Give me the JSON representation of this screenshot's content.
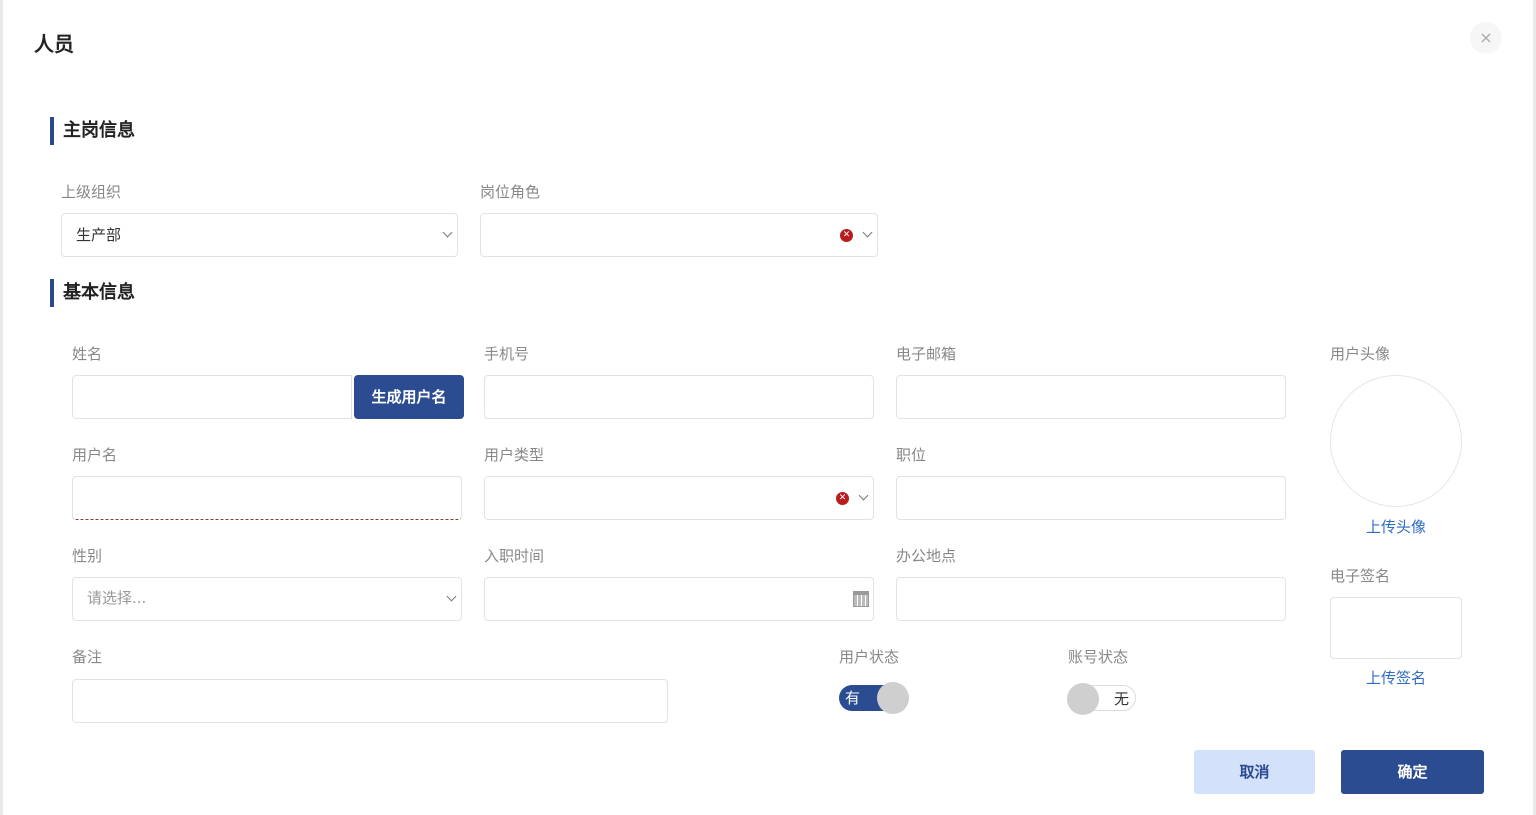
{
  "dialog": {
    "title": "人员",
    "close_symbol": "×"
  },
  "sections": {
    "main_post": "主岗信息",
    "basic_info": "基本信息"
  },
  "main_post": {
    "parent_org": {
      "label": "上级组织",
      "value": "生产部"
    },
    "post_role": {
      "label": "岗位角色",
      "value": ""
    }
  },
  "basic": {
    "name": {
      "label": "姓名",
      "value": ""
    },
    "generate_username_button": "生成用户名",
    "phone": {
      "label": "手机号",
      "value": ""
    },
    "email": {
      "label": "电子邮箱",
      "value": ""
    },
    "username": {
      "label": "用户名",
      "value": ""
    },
    "user_type": {
      "label": "用户类型",
      "value": ""
    },
    "position": {
      "label": "职位",
      "value": ""
    },
    "gender": {
      "label": "性别",
      "placeholder": "请选择..."
    },
    "hire_date": {
      "label": "入职时间",
      "value": ""
    },
    "office_location": {
      "label": "办公地点",
      "value": ""
    },
    "remark": {
      "label": "备注",
      "value": ""
    },
    "user_status": {
      "label": "用户状态",
      "toggle_text": "有",
      "enabled": true
    },
    "account_status": {
      "label": "账号状态",
      "toggle_text": "无",
      "enabled": false
    },
    "avatar": {
      "label": "用户头像",
      "upload_link": "上传头像"
    },
    "signature": {
      "label": "电子签名",
      "upload_link": "上传签名"
    }
  },
  "footer": {
    "cancel_label": "取消",
    "confirm_label": "确定"
  },
  "colors": {
    "primary": "#2c4c91",
    "cancel_bg": "#d4e1fb",
    "link": "#2f6dc2",
    "error": "#b81c1c"
  },
  "icons": {
    "close": "close-icon",
    "chevron": "chevron-down-icon",
    "clear": "clear-icon",
    "calendar": "calendar-icon"
  }
}
